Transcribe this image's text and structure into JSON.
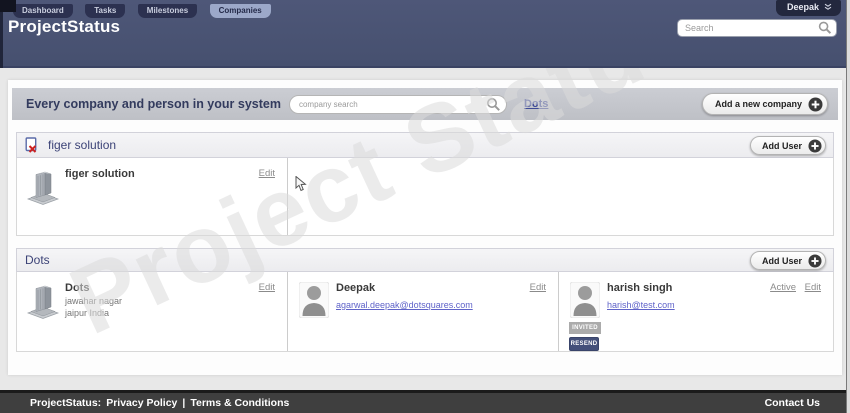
{
  "header": {
    "title": "ProjectStatus",
    "tabs": [
      {
        "label": "Dashboard"
      },
      {
        "label": "Tasks"
      },
      {
        "label": "Milestones"
      },
      {
        "label": "Companies"
      }
    ],
    "active_tab": "Companies",
    "user_button": {
      "label": "Deepak"
    },
    "search": {
      "placeholder": "Search"
    }
  },
  "toolbar": {
    "heading": "Every company and person in your system",
    "company_search_placeholder": "company search",
    "company_link": "Dots",
    "add_company_label": "Add a new company"
  },
  "sections": {
    "figer": {
      "title": "figer solution",
      "add_user_label": "Add User",
      "company": {
        "name": "figer solution",
        "edit_label": "Edit"
      }
    },
    "dots": {
      "title": "Dots",
      "add_user_label": "Add User",
      "company": {
        "name": "Dots",
        "address_line1": "jawahar nagar",
        "address_line2": "jaipur India",
        "edit_label": "Edit"
      },
      "person1": {
        "name": "Deepak",
        "email": "agarwal.deepak@dotsquares.com",
        "edit_label": "Edit"
      },
      "person2": {
        "name": "harish singh",
        "email": "harish@test.com",
        "active_label": "Active",
        "edit_label": "Edit",
        "status_badge": "INVITED",
        "resend_label": "RESEND"
      }
    }
  },
  "footer": {
    "brand": "ProjectStatus:",
    "privacy": "Privacy Policy",
    "separator": "|",
    "terms": "Terms & Conditions",
    "contact": "Contact Us"
  },
  "watermark": "Project Status",
  "colors": {
    "header_bg": "#4a5373",
    "active_tab_bg": "#9ca8c9",
    "inactive_tab_bg": "#2c3150",
    "toolbar_bg": "#c4c6cb",
    "link_navy": "#3e4a96",
    "email_link": "#5f63c9",
    "resend_bg": "#44507a",
    "invited_bg": "#ababab",
    "footer_bg": "#3f3f3f"
  }
}
